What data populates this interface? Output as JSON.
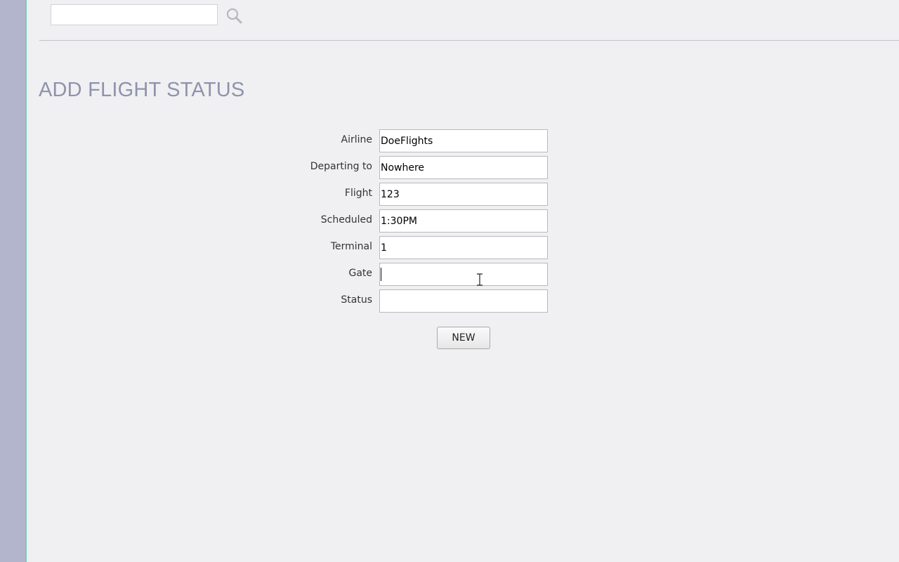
{
  "search": {
    "value": "",
    "placeholder": ""
  },
  "page": {
    "title": "ADD FLIGHT STATUS"
  },
  "form": {
    "fields": [
      {
        "label": "Airline",
        "value": "DoeFlights"
      },
      {
        "label": "Departing to",
        "value": "Nowhere"
      },
      {
        "label": "Flight",
        "value": "123"
      },
      {
        "label": "Scheduled",
        "value": "1:30PM"
      },
      {
        "label": "Terminal",
        "value": "1"
      },
      {
        "label": "Gate",
        "value": ""
      },
      {
        "label": "Status",
        "value": ""
      }
    ],
    "submit_label": "NEW"
  },
  "icons": {
    "search": "search-icon",
    "cursor": "text-cursor-icon"
  },
  "colors": {
    "sidebar": "#b3b5cc",
    "sidebar_edge": "#7fc8b8",
    "title": "#8e93ad",
    "background": "#f0f0f2"
  }
}
